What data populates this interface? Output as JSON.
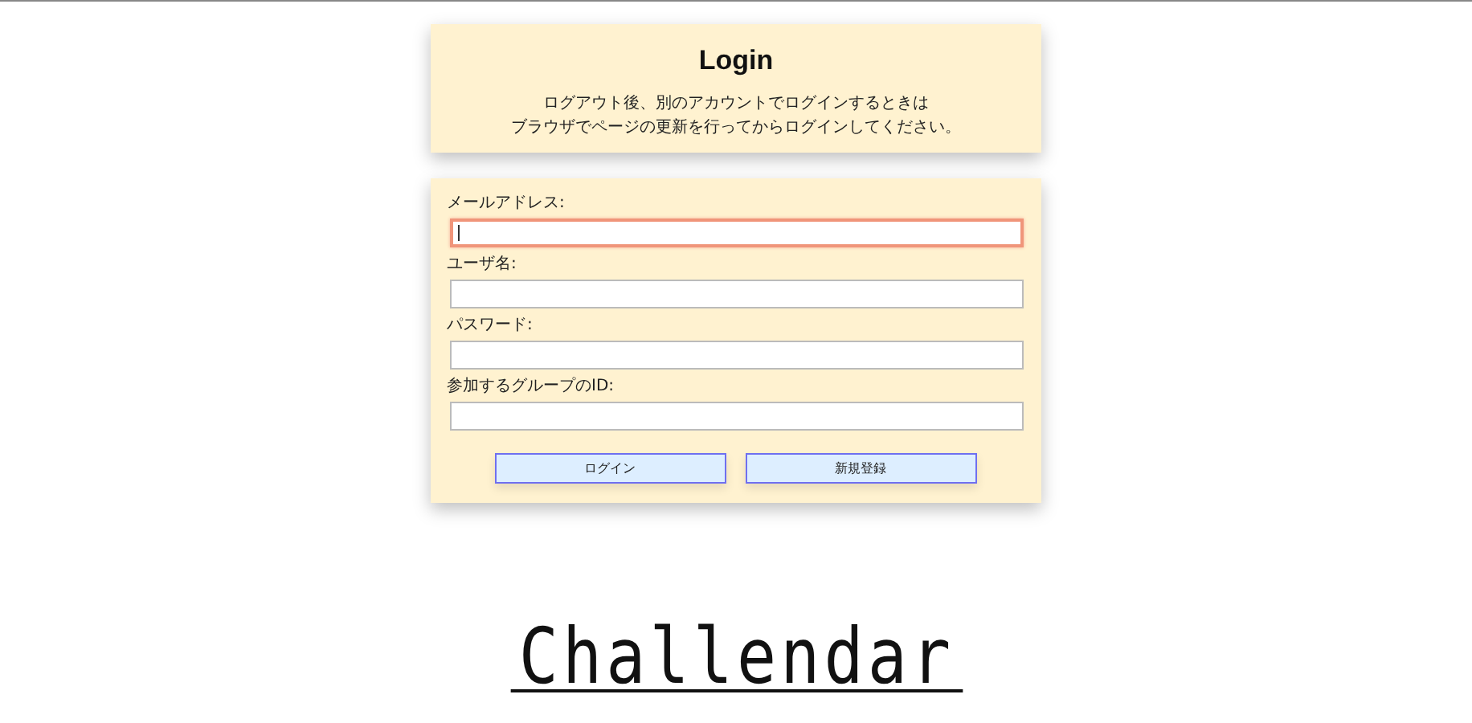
{
  "login_card": {
    "title": "Login",
    "notes": [
      "ログアウト後、別のアカウントでログインするときは",
      "ブラウザでページの更新を行ってからログインしてください。"
    ]
  },
  "form": {
    "fields": [
      {
        "label": "メールアドレス:",
        "focused": true
      },
      {
        "label": "ユーザ名:",
        "focused": false
      },
      {
        "label": "パスワード:",
        "focused": false
      },
      {
        "label": "参加するグループのID:",
        "focused": false
      }
    ],
    "buttons": [
      "ログイン",
      "新規登録"
    ]
  },
  "logo": {
    "text": "Challendar"
  }
}
